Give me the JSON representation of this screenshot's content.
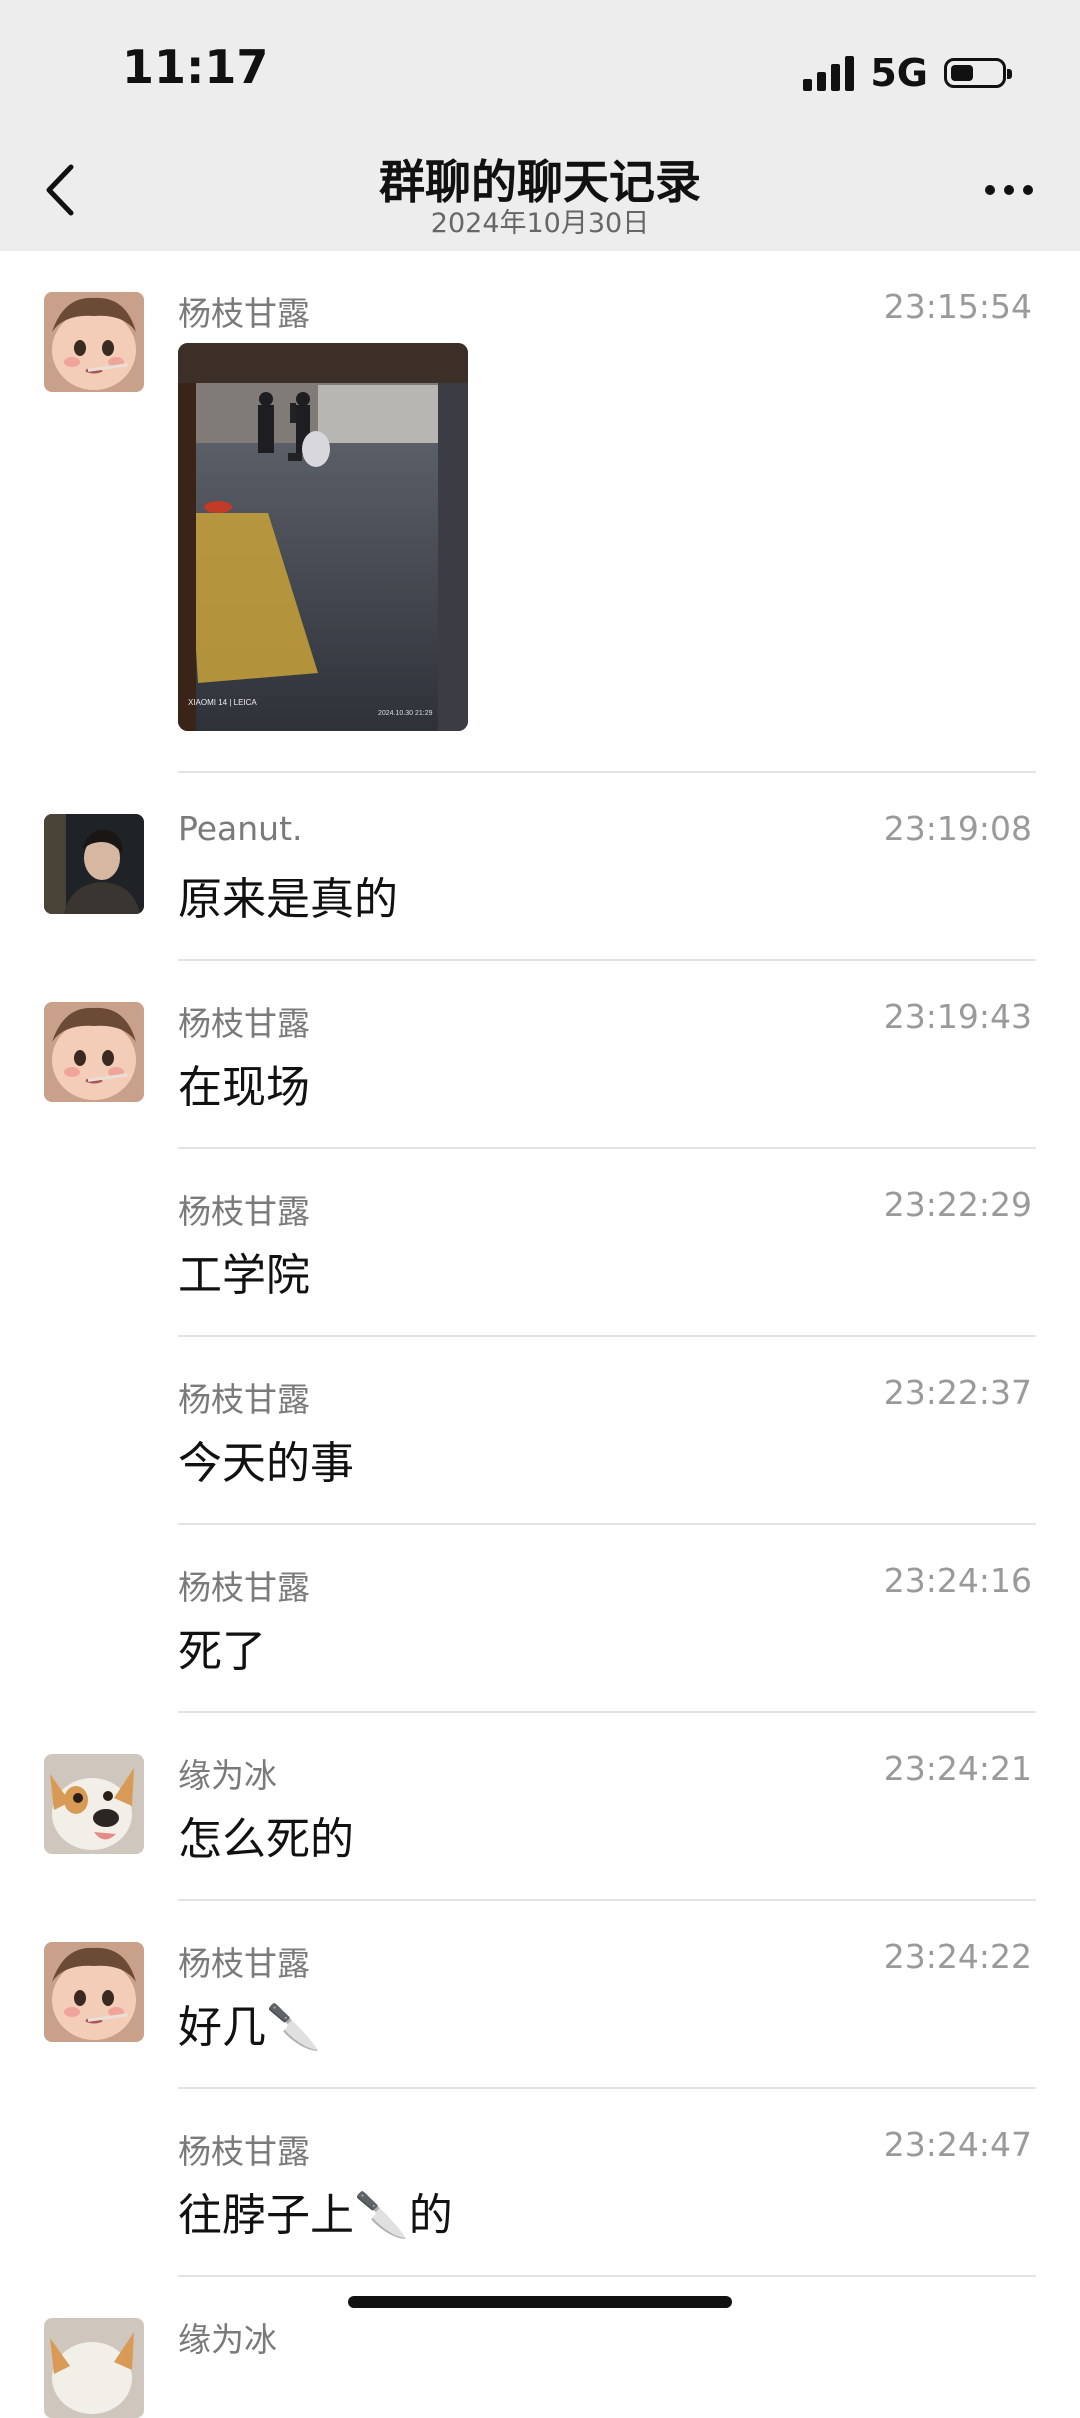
{
  "status_bar": {
    "time": "11:17",
    "network": "5G",
    "battery_level": 0.45
  },
  "header": {
    "title": "群聊的聊天记录",
    "date": "2024年10月30日"
  },
  "messages": [
    {
      "sender": "杨枝甘露",
      "time": "23:15:54",
      "text": "",
      "avatar": "cartoon-girl",
      "has_image": true
    },
    {
      "sender": "Peanut.",
      "time": "23:19:08",
      "text": "原来是真的",
      "avatar": "man-photo"
    },
    {
      "sender": "杨枝甘露",
      "time": "23:19:43",
      "text": "在现场",
      "avatar": "cartoon-girl"
    },
    {
      "sender": "杨枝甘露",
      "time": "23:22:29",
      "text": "工学院",
      "avatar": ""
    },
    {
      "sender": "杨枝甘露",
      "time": "23:22:37",
      "text": "今天的事",
      "avatar": ""
    },
    {
      "sender": "杨枝甘露",
      "time": "23:24:16",
      "text": "死了",
      "avatar": ""
    },
    {
      "sender": "缘为冰",
      "time": "23:24:21",
      "text": "怎么死的",
      "avatar": "dog"
    },
    {
      "sender": "杨枝甘露",
      "time": "23:24:22",
      "text": "好几🔪",
      "avatar": "cartoon-girl"
    },
    {
      "sender": "杨枝甘露",
      "time": "23:24:47",
      "text": "往脖子上🔪的",
      "avatar": ""
    },
    {
      "sender": "缘为冰",
      "time": "",
      "text": "",
      "avatar": "dog"
    }
  ],
  "photo_caption": {
    "brand": "XIAOMI 14 | LEICA",
    "stamp": "2024.10.30  21:29"
  },
  "colors": {
    "header_bg": "#ededed",
    "divider": "#e3e3e3",
    "name": "#7a7a7a",
    "time": "#9a9a9a"
  }
}
